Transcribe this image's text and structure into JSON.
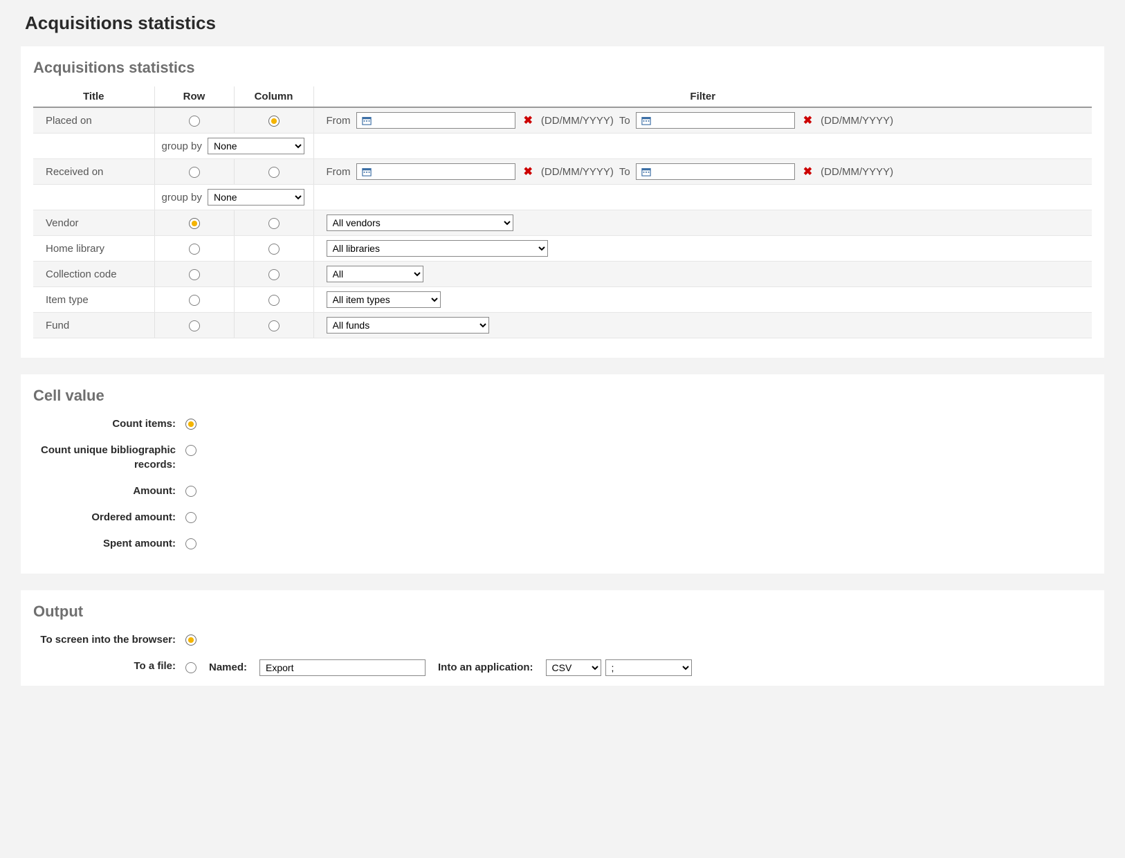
{
  "page_title": "Acquisitions statistics",
  "section1_title": "Acquisitions statistics",
  "table_headers": {
    "title": "Title",
    "row": "Row",
    "column": "Column",
    "filter": "Filter"
  },
  "date_labels": {
    "from": "From",
    "to": "To",
    "format": "(DD/MM/YYYY)"
  },
  "group_by_label": "group by",
  "group_by_options": [
    "None"
  ],
  "rows": {
    "placed_on": {
      "label": "Placed on",
      "group_by": "None"
    },
    "received_on": {
      "label": "Received on",
      "group_by": "None"
    },
    "vendor": {
      "label": "Vendor",
      "select": "All vendors"
    },
    "home_library": {
      "label": "Home library",
      "select": "All libraries"
    },
    "collection_code": {
      "label": "Collection code",
      "select": "All"
    },
    "item_type": {
      "label": "Item type",
      "select": "All item types"
    },
    "fund": {
      "label": "Fund",
      "select": "All funds"
    }
  },
  "cell_value": {
    "title": "Cell value",
    "count_items": "Count items:",
    "count_unique": "Count unique bibliographic records:",
    "amount": "Amount:",
    "ordered_amount": "Ordered amount:",
    "spent_amount": "Spent amount:"
  },
  "output": {
    "title": "Output",
    "to_screen": "To screen into the browser:",
    "to_file": "To a file:",
    "named_label": "Named:",
    "named_value": "Export",
    "app_label": "Into an application:",
    "app_format": "CSV",
    "app_delimiter": ";"
  }
}
